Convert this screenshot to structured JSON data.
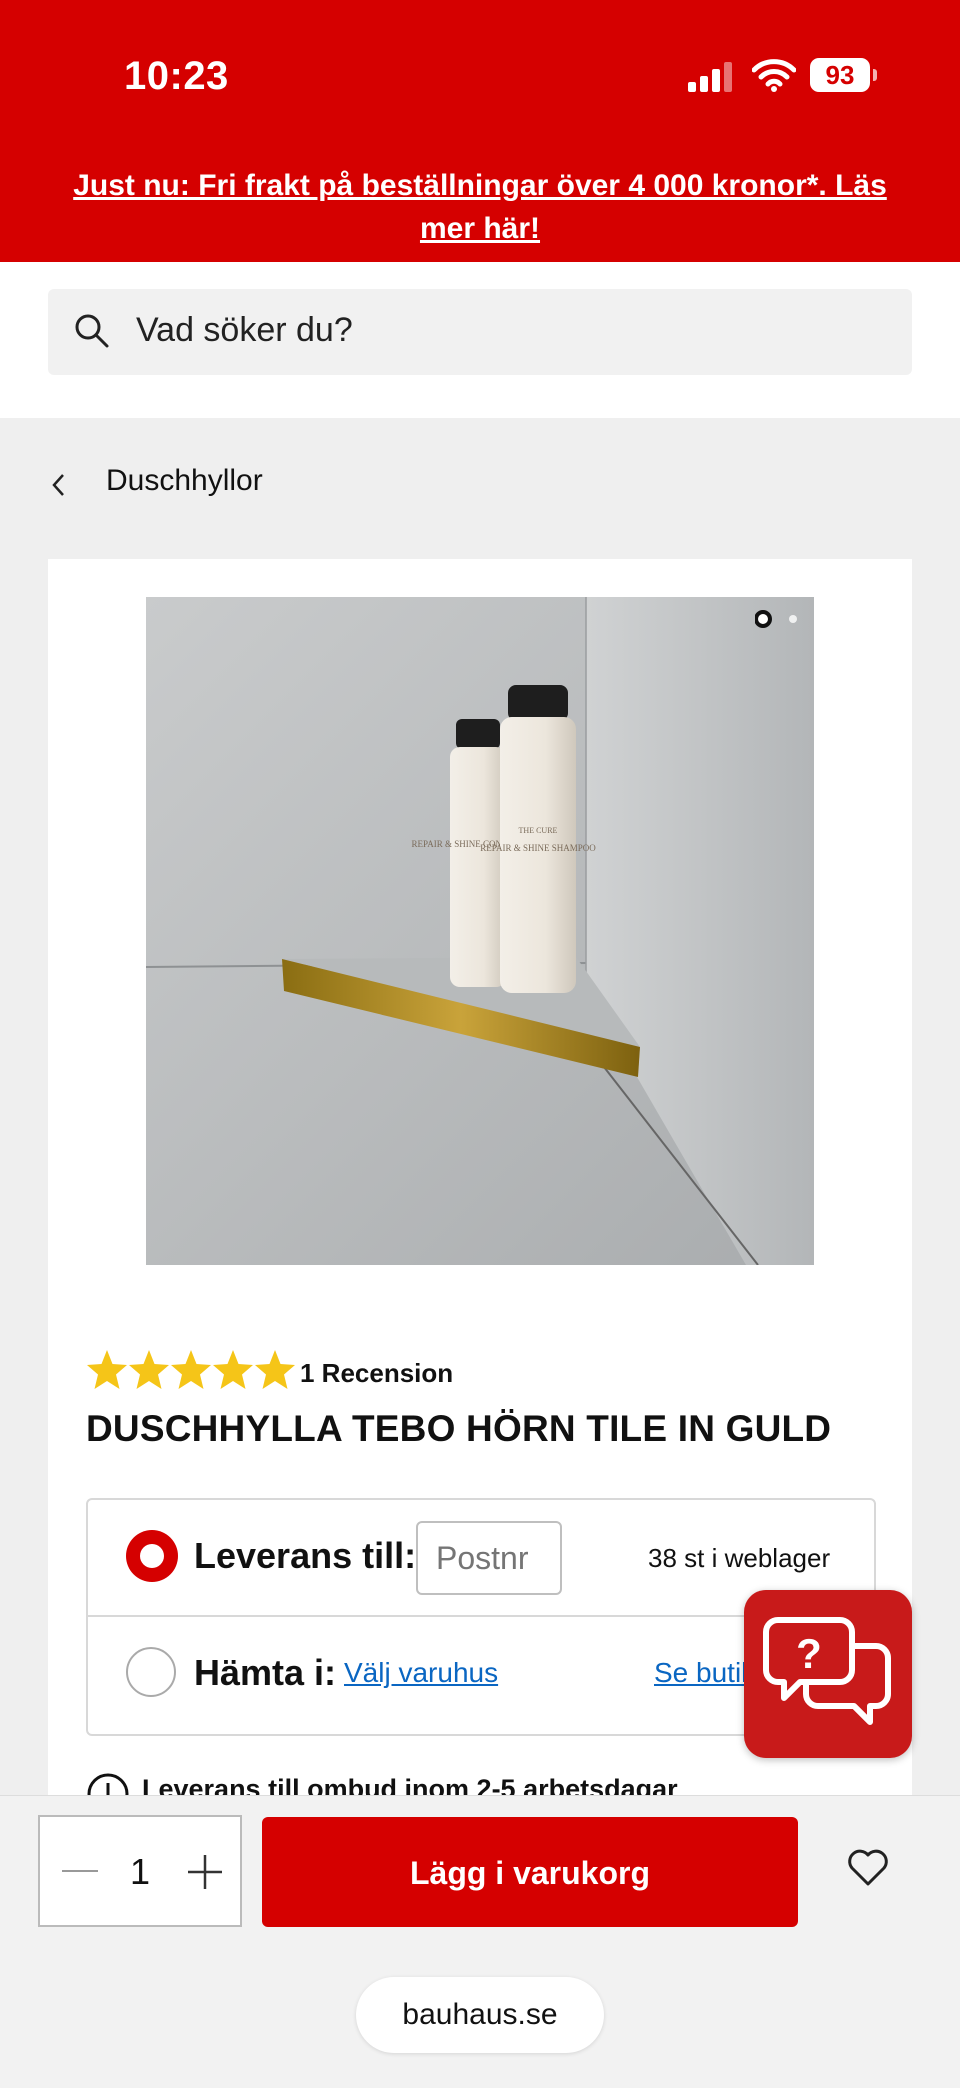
{
  "status_bar": {
    "time": "10:23",
    "battery": "93"
  },
  "banner": {
    "text": "Just nu: Fri frakt på beställningar över 4 000 kronor*. Läs mer här!"
  },
  "search": {
    "placeholder": "Vad söker du?"
  },
  "breadcrumb": {
    "label": "Duschhyllor"
  },
  "product": {
    "rating": 5,
    "review_count": "1 Recension",
    "title": "DUSCHHYLLA TEBO HÖRN TILE IN GULD",
    "image_count": 2,
    "active_image": 1,
    "bottle_left_label": "REPAIR & SHINE CONDITIONER",
    "bottle_right_label": "REPAIR & SHINE SHAMPOO",
    "bottle_brand": "THE CURE"
  },
  "delivery_options": {
    "leverans_label": "Leverans till:",
    "postnr_placeholder": "Postnr",
    "stock": "38 st i weblager",
    "hamta_label": "Hämta i:",
    "choose_store": "Välj varuhus",
    "see_store": "Se butik"
  },
  "delivery_info": "Leverans till ombud inom 2-5 arbetsdagar",
  "cart": {
    "quantity": "1",
    "add_label": "Lägg i varukorg"
  },
  "browser": {
    "url": "bauhaus.se"
  },
  "colors": {
    "brand_red": "#d50000",
    "link_blue": "#0a66c2",
    "star_yellow": "#f5c518"
  }
}
